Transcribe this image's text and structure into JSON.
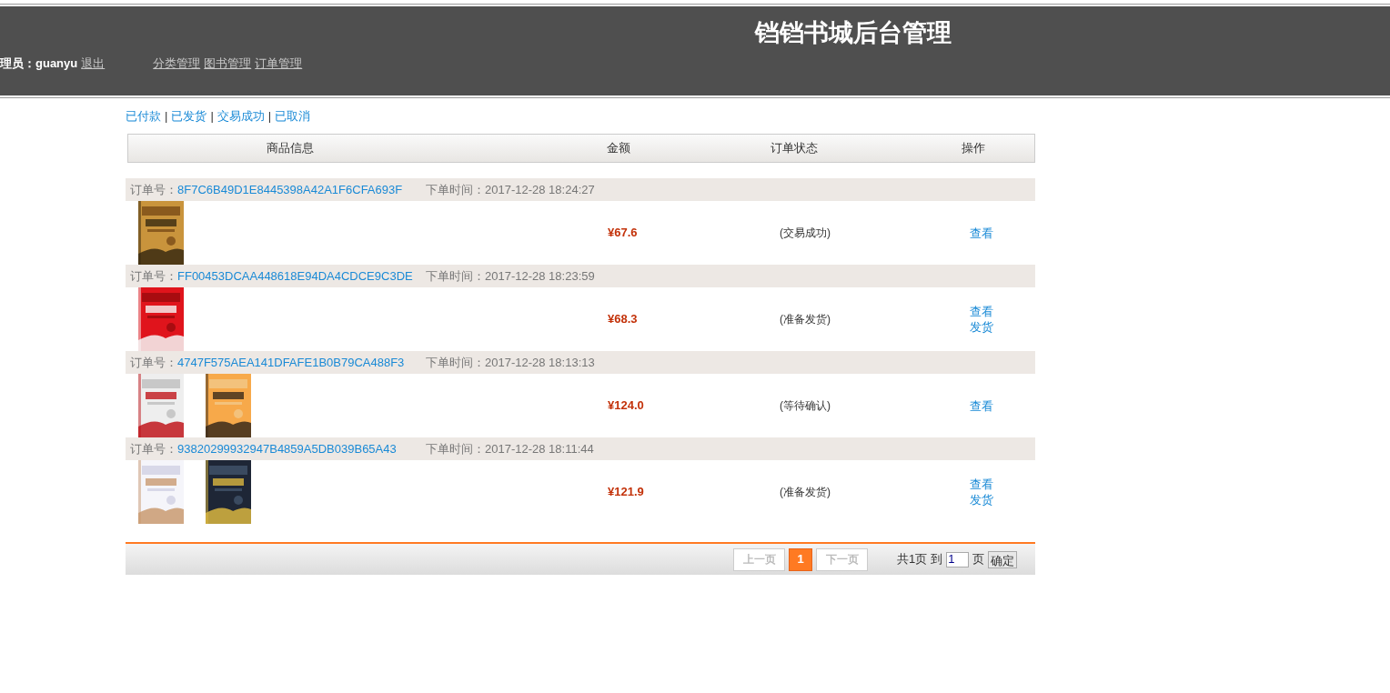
{
  "header": {
    "title": "铛铛书城后台管理",
    "admin_label": "理员：",
    "admin_name": "guanyu",
    "logout": "退出",
    "nav": [
      "分类管理",
      "图书管理",
      "订单管理"
    ]
  },
  "filters": [
    "已付款",
    "已发货",
    "交易成功",
    "已取消"
  ],
  "filter_separator": "|",
  "columns": [
    "商品信息",
    "金额",
    "订单状态",
    "操作"
  ],
  "orders": [
    {
      "number_label": "订单号：",
      "number": "8F7C6B49D1E8445398A42A1F6CFA693F",
      "time_label": "下单时间：",
      "time": "2017-12-28 18:24:27",
      "covers": [
        {
          "kind": "picture"
        }
      ],
      "amount": "¥67.6",
      "status": "(交易成功)",
      "actions": [
        "查看"
      ]
    },
    {
      "number_label": "订单号：",
      "number": "FF00453DCAA448618E94DA4CDCE9C3DE",
      "time_label": "下单时间：",
      "time": "2017-12-28 18:23:59",
      "covers": [
        {
          "kind": "picture"
        }
      ],
      "amount": "¥68.3",
      "status": "(准备发货)",
      "actions": [
        "查看",
        "发货"
      ]
    },
    {
      "number_label": "订单号：",
      "number": "4747F575AEA141DFAFE1B0B79CA488F3",
      "time_label": "下单时间：",
      "time": "2017-12-28 18:13:13",
      "covers": [
        {
          "kind": "picture"
        },
        {
          "kind": "picture"
        }
      ],
      "amount": "¥124.0",
      "status": "(等待确认)",
      "actions": [
        "查看"
      ]
    },
    {
      "number_label": "订单号：",
      "number": "93820299932947B4859A5DB039B65A43",
      "time_label": "下单时间：",
      "time": "2017-12-28 18:11:44",
      "covers": [
        {
          "kind": "picture"
        },
        {
          "kind": "picture"
        }
      ],
      "amount": "¥121.9",
      "status": "(准备发货)",
      "actions": [
        "查看",
        "发货"
      ]
    }
  ],
  "pagination": {
    "prev": "上一页",
    "pages": [
      {
        "label": "1",
        "selected": true
      }
    ],
    "next": "下一页",
    "total": "共1页",
    "goto": "到",
    "page_value": "1",
    "unit": "页",
    "confirm": "确定"
  }
}
